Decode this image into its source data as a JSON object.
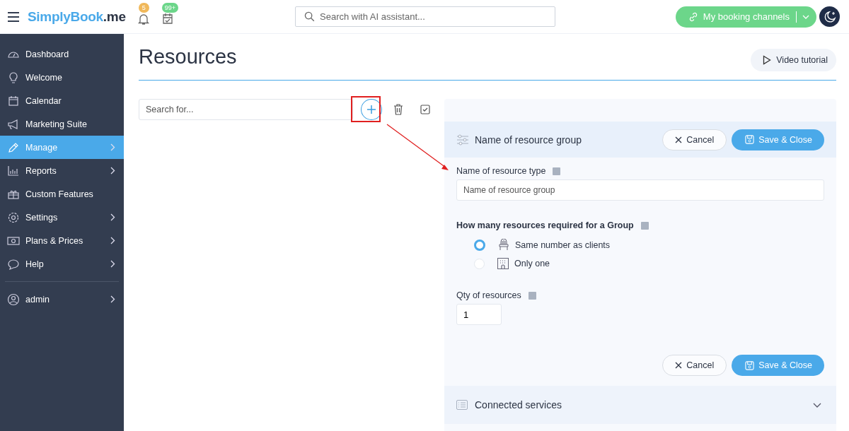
{
  "header": {
    "logo": {
      "name": "SimplyBook",
      "suffix": ".me"
    },
    "notifications": [
      {
        "badge": "5",
        "color": "#f0b85a"
      },
      {
        "badge": "99+",
        "color": "#6cd68a"
      }
    ],
    "search": {
      "placeholder": "Search with AI assistant..."
    },
    "booking_button": {
      "label": "My booking channels"
    }
  },
  "sidebar": {
    "items": [
      {
        "label": "Dashboard",
        "selected": false,
        "has_submenu": false
      },
      {
        "label": "Welcome",
        "selected": false,
        "has_submenu": false
      },
      {
        "label": "Calendar",
        "selected": false,
        "has_submenu": false
      },
      {
        "label": "Marketing Suite",
        "selected": false,
        "has_submenu": false
      },
      {
        "label": "Manage",
        "selected": true,
        "has_submenu": true
      },
      {
        "label": "Reports",
        "selected": false,
        "has_submenu": true
      },
      {
        "label": "Custom Features",
        "selected": false,
        "has_submenu": false
      },
      {
        "label": "Settings",
        "selected": false,
        "has_submenu": true
      },
      {
        "label": "Plans & Prices",
        "selected": false,
        "has_submenu": true
      },
      {
        "label": "Help",
        "selected": false,
        "has_submenu": true
      }
    ],
    "user": {
      "label": "admin"
    }
  },
  "page": {
    "title": "Resources",
    "video_button": "Video tutorial",
    "list_search": {
      "placeholder": "Search for..."
    }
  },
  "editor": {
    "title": "Name of resource group",
    "cancel": "Cancel",
    "save": "Save & Close",
    "name_field": {
      "label": "Name of resource type",
      "placeholder": "Name of resource group"
    },
    "group_question": "How many resources required for a Group",
    "options": [
      {
        "label": "Same number as clients",
        "selected": true
      },
      {
        "label": "Only one",
        "selected": false
      }
    ],
    "qty_field": {
      "label": "Qty of resources",
      "value": "1"
    },
    "footer_cancel": "Cancel",
    "footer_save": "Save & Close",
    "sections": [
      {
        "title": "Connected services",
        "expanded": false
      }
    ]
  }
}
